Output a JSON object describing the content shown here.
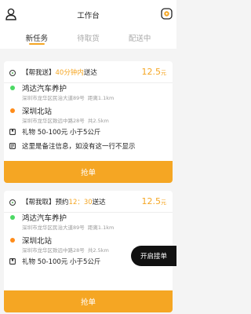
{
  "header": {
    "title": "工作台"
  },
  "tabs": [
    {
      "label": "新任务",
      "active": true
    },
    {
      "label": "待取货",
      "active": false
    },
    {
      "label": "配送中",
      "active": false
    }
  ],
  "orders": [
    {
      "tag": "【帮我送】",
      "time_highlight": "40分钟内",
      "time_suffix": "送达",
      "price": "12.5",
      "price_unit": "元",
      "pickup": {
        "name": "鸿达汽车养护",
        "address": "深圳市龙华区民治大道89号",
        "distance": "距离1.1km"
      },
      "dropoff": {
        "name": "深圳北站",
        "address": "深圳市龙华区致远中路28号",
        "distance": "共2.5km"
      },
      "goods": "礼物  50-100元  小于5公斤",
      "note": "这里是备注信息，如没有这一行不显示",
      "button": "抢单"
    },
    {
      "tag": "【帮我取】",
      "time_prefix": "预约",
      "time_highlight": "12：30",
      "time_suffix": "送达",
      "price": "12.5",
      "price_unit": "元",
      "pickup": {
        "name": "鸿达汽车养护",
        "address": "深圳市龙华区民治大道89号",
        "distance": "距离1.1km"
      },
      "dropoff": {
        "name": "深圳北站",
        "address": "深圳市龙华区致远中路28号",
        "distance": "共2.5km"
      },
      "goods": "礼物  50-100元  小于5公斤",
      "button": "抢单"
    }
  ],
  "fab": {
    "label": "开启接单"
  },
  "colors": {
    "accent": "#f5a623",
    "pickup_dot": "#4cd964",
    "dropoff_dot": "#ff8c1a"
  }
}
